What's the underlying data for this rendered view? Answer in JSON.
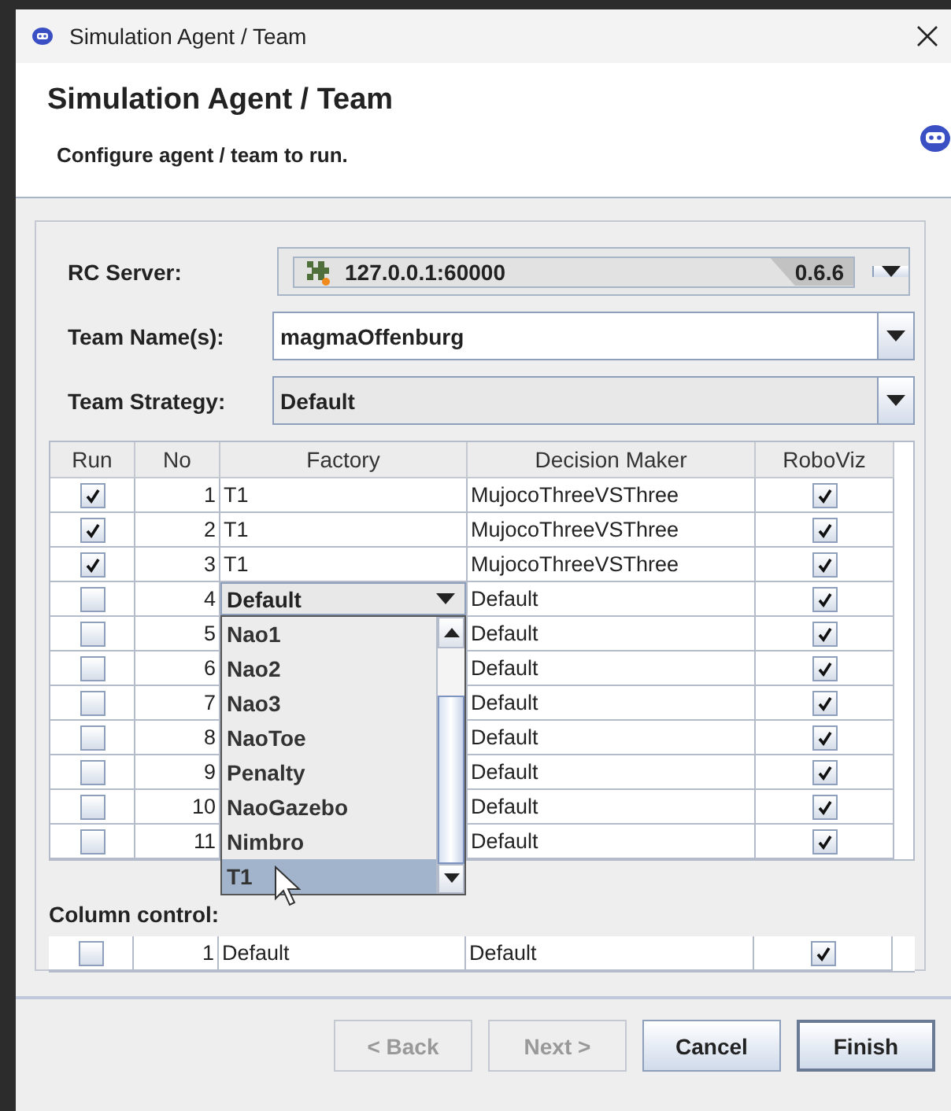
{
  "window": {
    "title": "Simulation Agent / Team"
  },
  "header": {
    "title": "Simulation Agent / Team",
    "subtitle": "Configure agent / team to run."
  },
  "form": [
    {
      "label": "RC Server:",
      "kind": "server",
      "value": "127.0.0.1:60000",
      "version": "0.6.6"
    },
    {
      "label": "Team Name(s):",
      "kind": "editable",
      "value": "magmaOffenburg"
    },
    {
      "label": "Team Strategy:",
      "kind": "readonly",
      "value": "Default"
    }
  ],
  "table": {
    "columns": [
      "Run",
      "No",
      "Factory",
      "Decision Maker",
      "RoboViz"
    ],
    "rows": [
      {
        "run": true,
        "no": "1",
        "factory": "T1",
        "decision_maker": "MujocoThreeVSThree",
        "roboviz": true
      },
      {
        "run": true,
        "no": "2",
        "factory": "T1",
        "decision_maker": "MujocoThreeVSThree",
        "roboviz": true
      },
      {
        "run": true,
        "no": "3",
        "factory": "T1",
        "decision_maker": "MujocoThreeVSThree",
        "roboviz": true
      },
      {
        "run": false,
        "no": "4",
        "factory": "Default",
        "editing": true,
        "decision_maker": "Default",
        "roboviz": true
      },
      {
        "run": false,
        "no": "5",
        "decision_maker": "Default",
        "roboviz": true
      },
      {
        "run": false,
        "no": "6",
        "decision_maker": "Default",
        "roboviz": true
      },
      {
        "run": false,
        "no": "7",
        "decision_maker": "Default",
        "roboviz": true
      },
      {
        "run": false,
        "no": "8",
        "decision_maker": "Default",
        "roboviz": true
      },
      {
        "run": false,
        "no": "9",
        "decision_maker": "Default",
        "roboviz": true
      },
      {
        "run": false,
        "no": "10",
        "decision_maker": "Default",
        "roboviz": true
      },
      {
        "run": false,
        "no": "11",
        "decision_maker": "Default",
        "roboviz": true
      }
    ]
  },
  "factory_dropdown": {
    "items": [
      {
        "label": "Nao1",
        "selected": false
      },
      {
        "label": "Nao2",
        "selected": false
      },
      {
        "label": "Nao3",
        "selected": false
      },
      {
        "label": "NaoToe",
        "selected": false
      },
      {
        "label": "Penalty",
        "selected": false
      },
      {
        "label": "NaoGazebo",
        "selected": false
      },
      {
        "label": "Nimbro",
        "selected": false
      },
      {
        "label": "T1",
        "selected": true
      }
    ]
  },
  "column_control": {
    "label": "Column control:",
    "row": {
      "run": false,
      "no": "1",
      "factory": "Default",
      "decision_maker": "Default",
      "roboviz": true
    }
  },
  "buttons": [
    {
      "label": "< Back",
      "disabled": true
    },
    {
      "label": "Next >",
      "disabled": true
    },
    {
      "label": "Cancel",
      "disabled": false
    },
    {
      "label": "Finish",
      "disabled": false
    }
  ]
}
